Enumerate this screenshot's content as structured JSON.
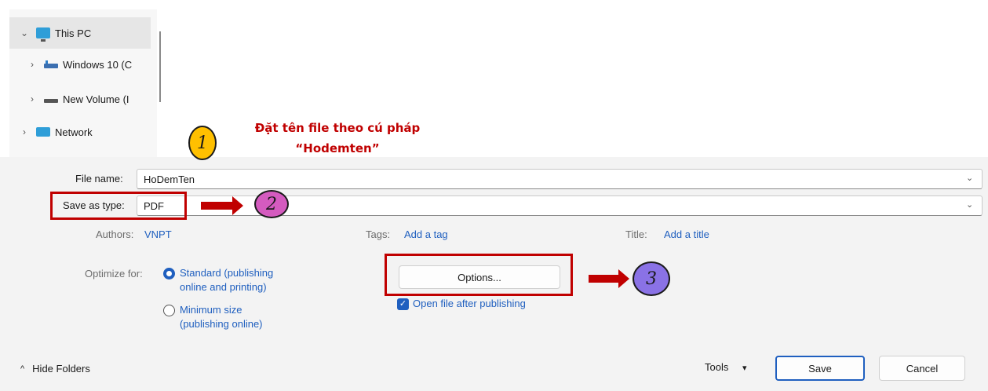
{
  "nav": {
    "items": [
      {
        "label": "This PC",
        "chevron": "⌄"
      },
      {
        "label": "Windows 10 (C",
        "chevron": "›"
      },
      {
        "label": "New Volume (I",
        "chevron": "›"
      },
      {
        "label": "Network",
        "chevron": "›"
      }
    ]
  },
  "annotation": {
    "line1": "Đặt tên file theo cú pháp",
    "line2": "“Hodemten”",
    "badge1": "1",
    "badge2": "2",
    "badge3": "3"
  },
  "form": {
    "file_name_label": "File name:",
    "file_name_value": "HoDemTen",
    "save_type_label": "Save as type:",
    "save_type_value": "PDF",
    "authors_label": "Authors:",
    "authors_value": "VNPT",
    "tags_label": "Tags:",
    "tags_value": "Add a tag",
    "title_label": "Title:",
    "title_value": "Add a title",
    "optimize_label": "Optimize for:",
    "opt_standard_1": "Standard (publishing",
    "opt_standard_2": "online and printing)",
    "opt_min_1": "Minimum size",
    "opt_min_2": "(publishing online)",
    "options_button": "Options...",
    "open_after": "Open file after publishing",
    "dropdown_glyph": "⌄"
  },
  "footer": {
    "hide_folders": "Hide Folders",
    "hide_glyph": "^",
    "tools": "Tools",
    "tools_glyph": "▾",
    "save": "Save",
    "cancel": "Cancel"
  },
  "colors": {
    "accent": "#1f5fbf",
    "annotation_red": "#c00000",
    "badge1": "#ffc000",
    "badge2": "#d45bbf",
    "badge3": "#8a72e6"
  }
}
